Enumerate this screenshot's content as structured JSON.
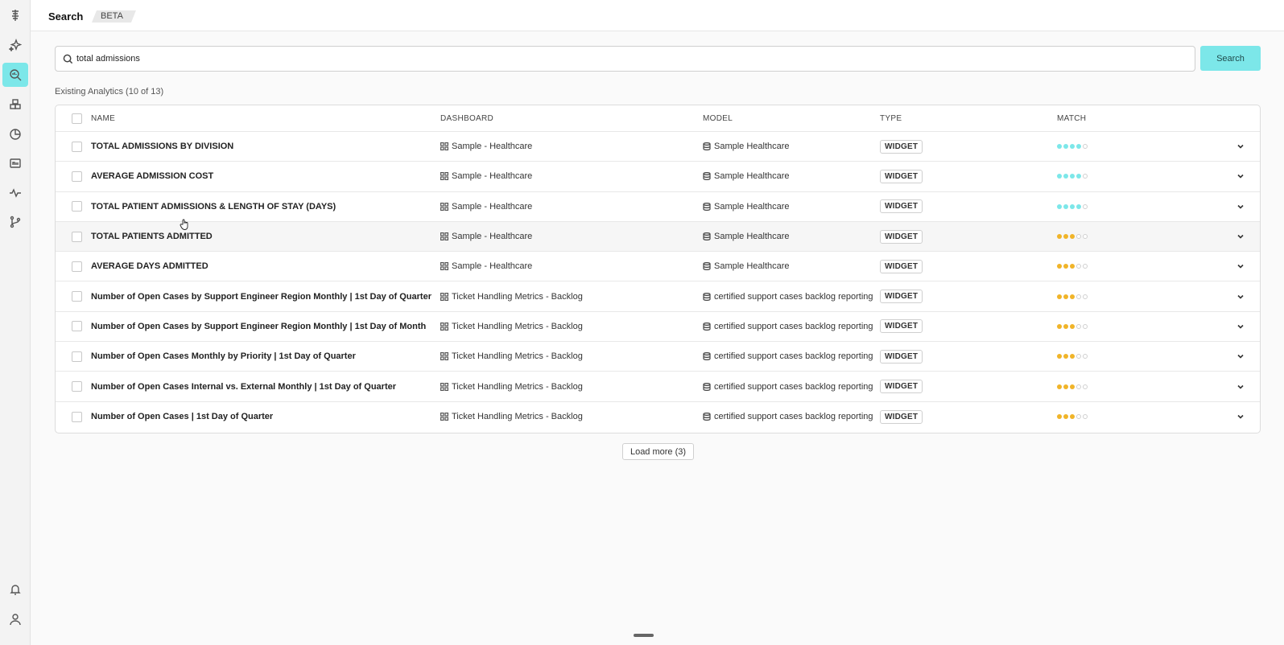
{
  "topbar": {
    "title": "Search",
    "badge": "BETA"
  },
  "sidebar": {
    "items": [
      {
        "icon": "layers-icon"
      },
      {
        "icon": "sparkle-icon"
      },
      {
        "icon": "search-analytics-icon",
        "active": true
      },
      {
        "icon": "cubes-icon"
      },
      {
        "icon": "pie-chart-icon"
      },
      {
        "icon": "api-icon"
      },
      {
        "icon": "pulse-icon"
      },
      {
        "icon": "branch-icon"
      }
    ],
    "bottom": [
      {
        "icon": "bell-icon"
      },
      {
        "icon": "user-icon"
      }
    ]
  },
  "search": {
    "value": "total admissions",
    "placeholder": "",
    "button_label": "Search"
  },
  "existing_label": "Existing Analytics (10 of 13)",
  "table": {
    "columns": [
      "NAME",
      "DASHBOARD",
      "MODEL",
      "TYPE",
      "MATCH"
    ],
    "rows": [
      {
        "name": "TOTAL ADMISSIONS BY DIVISION",
        "dashboard": "Sample - Healthcare",
        "model": "Sample Healthcare",
        "type": "WIDGET",
        "match": 4,
        "match_color": "#7ce7e9"
      },
      {
        "name": "AVERAGE ADMISSION COST",
        "dashboard": "Sample - Healthcare",
        "model": "Sample Healthcare",
        "type": "WIDGET",
        "match": 4,
        "match_color": "#7ce7e9"
      },
      {
        "name": "TOTAL PATIENT ADMISSIONS & LENGTH OF STAY (DAYS)",
        "dashboard": "Sample - Healthcare",
        "model": "Sample Healthcare",
        "type": "WIDGET",
        "match": 4,
        "match_color": "#7ce7e9"
      },
      {
        "name": "TOTAL PATIENTS ADMITTED",
        "dashboard": "Sample - Healthcare",
        "model": "Sample Healthcare",
        "type": "WIDGET",
        "match": 3,
        "match_color": "#f0b429",
        "hover": true
      },
      {
        "name": "AVERAGE DAYS ADMITTED",
        "dashboard": "Sample - Healthcare",
        "model": "Sample Healthcare",
        "type": "WIDGET",
        "match": 3,
        "match_color": "#f0b429"
      },
      {
        "name": "Number of Open Cases by Support Engineer Region Monthly | 1st Day of Quarter",
        "dashboard": "Ticket Handling Metrics - Backlog",
        "model": "certified support cases backlog reporting",
        "type": "WIDGET",
        "match": 3,
        "match_color": "#f0b429"
      },
      {
        "name": "Number of Open Cases by Support Engineer Region Monthly | 1st Day of Month",
        "dashboard": "Ticket Handling Metrics - Backlog",
        "model": "certified support cases backlog reporting",
        "type": "WIDGET",
        "match": 3,
        "match_color": "#f0b429"
      },
      {
        "name": "Number of Open Cases Monthly by Priority | 1st Day of Quarter",
        "dashboard": "Ticket Handling Metrics - Backlog",
        "model": "certified support cases backlog reporting",
        "type": "WIDGET",
        "match": 3,
        "match_color": "#f0b429"
      },
      {
        "name": "Number of Open Cases Internal vs. External Monthly | 1st Day of Quarter",
        "dashboard": "Ticket Handling Metrics - Backlog",
        "model": "certified support cases backlog reporting",
        "type": "WIDGET",
        "match": 3,
        "match_color": "#f0b429"
      },
      {
        "name": "Number of Open Cases | 1st Day of Quarter",
        "dashboard": "Ticket Handling Metrics - Backlog",
        "model": "certified support cases backlog reporting",
        "type": "WIDGET",
        "match": 3,
        "match_color": "#f0b429"
      }
    ],
    "match_max": 5
  },
  "load_more_label": "Load more (3)"
}
